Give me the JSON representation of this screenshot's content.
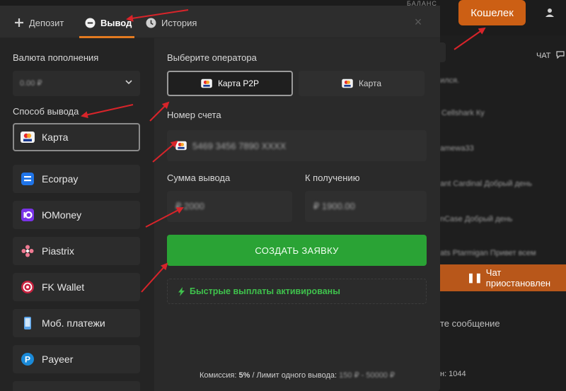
{
  "background": {
    "balance_label": "БАЛАНС",
    "wallet_button": "Кошелек",
    "chat_tab": "ЧАТ",
    "chat_lines": [
      "ился.",
      "Cellshark  Ку",
      "amewa33 ",
      "ant Cardinal  Добрый день",
      "nCase  Добрый день",
      "ats Ptarmigan  Привет всем"
    ],
    "chat_paused": "Чат приостановлен",
    "message_placeholder": "те сообщение",
    "online_count": "н: 1044"
  },
  "modal": {
    "tabs": [
      {
        "label": "Депозит"
      },
      {
        "label": "Вывод"
      },
      {
        "label": "История"
      }
    ],
    "close_label": "×",
    "currency_label": "Валюта пополнения",
    "currency_value": "0.00 ₽",
    "method_label": "Способ вывода",
    "methods": [
      {
        "label": "Карта"
      },
      {
        "label": "Ecorpay"
      },
      {
        "label": "ЮMoney"
      },
      {
        "label": "Piastrix"
      },
      {
        "label": "FK Wallet"
      },
      {
        "label": "Моб. платежи"
      },
      {
        "label": "Payeer"
      }
    ],
    "operator_label": "Выберите оператора",
    "operators": [
      {
        "label": "Карта P2P"
      },
      {
        "label": "Карта"
      }
    ],
    "account_label": "Номер счета",
    "account_value": "5469 3456 7890 XXXX",
    "amount_label": "Сумма вывода",
    "amount_value": "₽ 2000",
    "receive_label": "К получению",
    "receive_value": "₽ 1900.00",
    "create_button": "СОЗДАТЬ ЗАЯВКУ",
    "fast_payouts": "Быстрые выплаты активированы",
    "footer": {
      "commission_label": "Комиссия:",
      "commission_value": "5%",
      "limit_label": "/ Лимит одного вывода:",
      "limit_value": "150 ₽ - 50000 ₽"
    }
  },
  "colors": {
    "accent": "#e27a20",
    "wallet": "#cc5f14",
    "create": "#2aa335",
    "fast_green": "#3fc14c",
    "arrow_red": "#d8242a"
  }
}
